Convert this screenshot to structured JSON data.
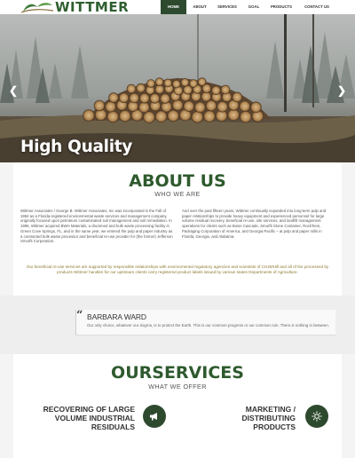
{
  "brand": {
    "name": "WITTMER"
  },
  "nav": {
    "items": [
      {
        "label": "HOME",
        "active": true
      },
      {
        "label": "ABOUT",
        "active": false
      },
      {
        "label": "SERVICES",
        "active": false
      },
      {
        "label": "GOAL",
        "active": false
      },
      {
        "label": "PRODUCTS",
        "active": false
      },
      {
        "label": "CONTACT US",
        "active": false
      }
    ]
  },
  "hero": {
    "title": "High Quality",
    "prev_icon": "chevron-left-icon",
    "next_icon": "chevron-right-icon"
  },
  "about": {
    "title": "ABOUT US",
    "subtitle": "WHO WE ARE",
    "paragraph_left": "Wittmer Associates / George B. Wittmer Associates, Inc was incorporated in the Fall of 1994 as a Florida-registered environmental waste services and management company, originally focused upon petroleum contaminated soil management and soil remediation. In 1996, Wittmer acquired BWH Materials, a drummed and bulk waste processing facility in Green Cove Springs, FL, and in the same year, we entered the pulp and paper industry as a contracted bulk waste processor and beneficial re-use provider for (the former) Jefferson Smurfit Corporation.",
    "paragraph_right": "And over the past fifteen years, Wittmer continually expanded into long-term pulp and paper relationships to provide heavy equipment and experienced personnel for large volume residual recovery, beneficial re-use, site services, and landfill management operations for clients such as Boise Cascade, Smurfit Stone Container, RockTenn, Packaging Corporation of America, and Georgia Pacific – at pulp and paper mills in Florida, Georgia, and Alabama.",
    "highlight": "Our beneficial re-use services are supported by responsible relationships with environmental regulatory agencies and scientists of CH2MHill and all of the processed by products Wittmer handles for our upstream clients carry registered product labels issued by various states Departments of Agriculture."
  },
  "testimonial": {
    "name": "BARBARA WARD",
    "text": "Our only choice, whatever our dogma, is to protect the Earth. This is our common progress or our common ruin. There is nothing in between.",
    "quote_icon": "quote-icon"
  },
  "services": {
    "title": "OURSERVICES",
    "subtitle": "WHAT WE OFFER",
    "items": [
      {
        "label": "RECOVERING OF LARGE VOLUME INDUSTRIAL RESIDUALS",
        "icon": "megaphone-icon"
      },
      {
        "label": "MARKETING / DISTRIBUTING PRODUCTS",
        "icon": "sun-icon"
      }
    ]
  },
  "colors": {
    "brand_green": "#2e5a2e",
    "nav_active": "#2e4a2e",
    "highlight_text": "#8d7a32"
  }
}
